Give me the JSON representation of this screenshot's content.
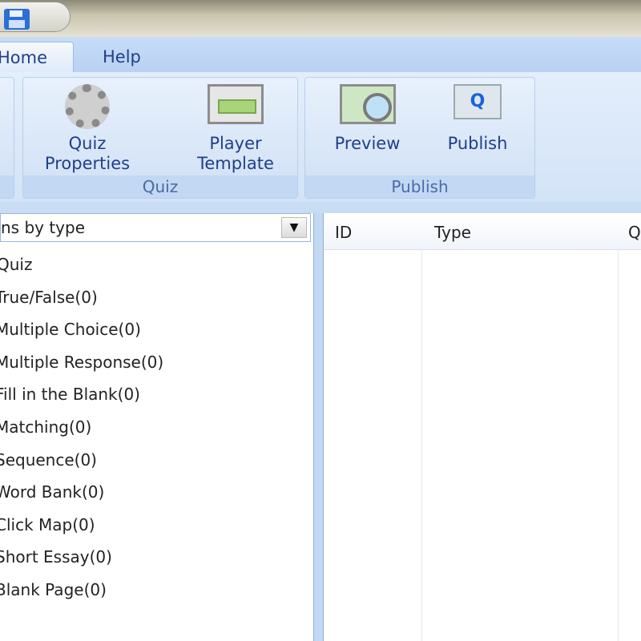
{
  "titlebar": {
    "save_icon": "save-icon"
  },
  "tabs": [
    {
      "label": "Home",
      "active": true
    },
    {
      "label": "Help",
      "active": false
    }
  ],
  "ribbon": {
    "groups": [
      {
        "label": "Quiz",
        "buttons": [
          {
            "label_line1": "Quiz",
            "label_line2": "Properties",
            "icon": "gear-icon"
          },
          {
            "label_line1": "Player",
            "label_line2": "Template",
            "icon": "template-icon"
          }
        ]
      },
      {
        "label": "Publish",
        "buttons": [
          {
            "label_line1": "Preview",
            "icon": "preview-icon"
          },
          {
            "label_line1": "Publish",
            "icon": "publish-icon",
            "glyph": "Q"
          }
        ]
      }
    ]
  },
  "left_panel": {
    "dropdown_value": "ns by type",
    "items": [
      "Quiz",
      "True/False(0)",
      "Multiple Choice(0)",
      "Multiple Response(0)",
      "Fill in the Blank(0)",
      "Matching(0)",
      "Sequence(0)",
      "Word Bank(0)",
      "Click Map(0)",
      "Short Essay(0)",
      "Blank Page(0)"
    ]
  },
  "right_panel": {
    "columns": [
      "ID",
      "Type",
      "Q"
    ]
  }
}
